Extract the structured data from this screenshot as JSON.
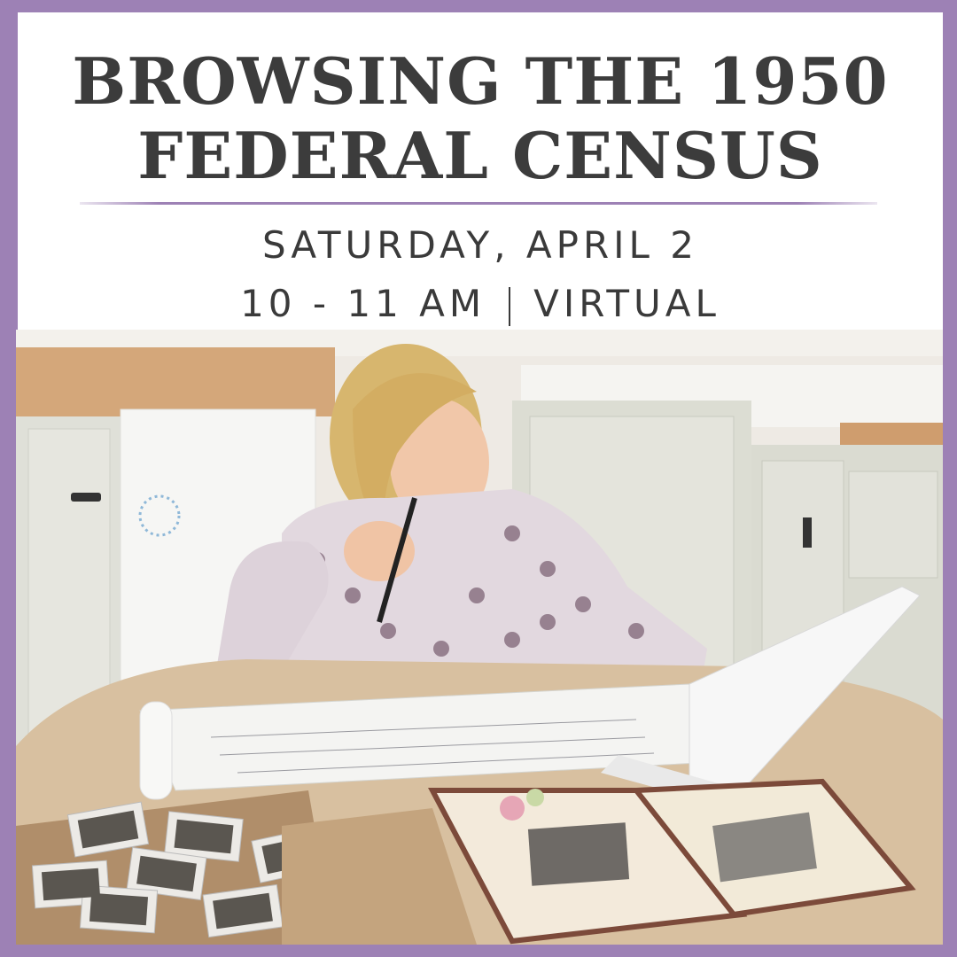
{
  "event": {
    "title_line1": "BROWSING THE 1950",
    "title_line2": "FEDERAL CENSUS",
    "date": "SATURDAY, APRIL 2",
    "time": "10 - 11 AM",
    "location": "VIRTUAL"
  },
  "photo": {
    "icon": "woman-researching-at-kitchen-table"
  },
  "colors": {
    "frame": "#9d81b5",
    "text": "#3c3c3c",
    "panel": "#ffffff"
  }
}
